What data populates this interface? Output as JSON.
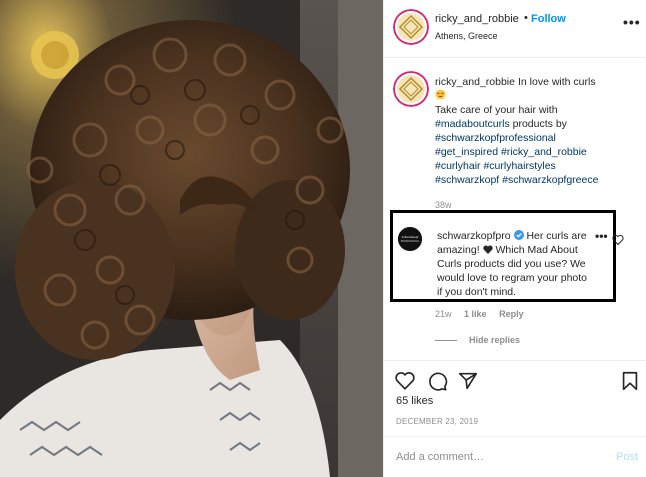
{
  "post": {
    "username": "ricky_and_robbie",
    "dot": "•",
    "follow_label": "Follow",
    "location": "Athens, Greece",
    "more": "•••"
  },
  "caption": {
    "username": "ricky_and_robbie",
    "line1": "In love with curls",
    "line2": "Take care of your hair with",
    "tags": [
      "#madaboutcurls",
      "#schwarzkopfprofessional",
      "#get_inspired",
      "#ricky_and_robbie",
      "#curlyhair",
      "#curlyhairstyles",
      "#schwarzkopf",
      "#schwarzkopfgreece"
    ],
    "after_tag1": " products by",
    "time": "38w"
  },
  "comment": {
    "username": "schwarzkopfpro",
    "text_a": "Her curls are amazing!",
    "text_b": "Which Mad About Curls products did you use? We would love to regram your photo if you don't mind.",
    "more": "•••",
    "time": "21w",
    "likes": "1 like",
    "reply": "Reply",
    "hide_replies": "Hide replies"
  },
  "actions": {
    "likes_count": "65 likes",
    "date": "DECEMBER 23, 2019"
  },
  "composer": {
    "placeholder": "Add a comment…",
    "post_label": "Post"
  },
  "colors": {
    "accent": "#0095f6",
    "hashtag": "#00376b",
    "muted": "#8e8e8e",
    "post_disabled": "#b2dffc"
  }
}
